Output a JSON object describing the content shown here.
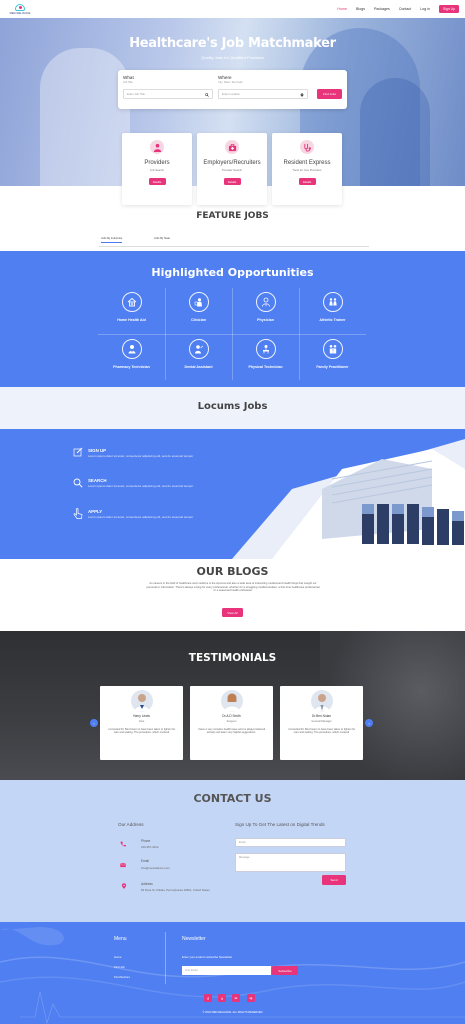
{
  "nav": {
    "logo_text": "MED-RELIANCE",
    "links": [
      "Home",
      "Blogs",
      "Packages",
      "Contact",
      "Log in"
    ],
    "signup_label": "Sign Up"
  },
  "hero": {
    "title": "Healthcare's Job Matchmaker",
    "subtitle": "Quality Jobs for Qualified Providers",
    "what_label": "What",
    "what_hint": "Job Title",
    "what_placeholder": "Enter Job Title",
    "where_label": "Where",
    "where_hint": "City, State / Zip Code",
    "where_placeholder": "Enter Location",
    "find_label": "Find Jobs"
  },
  "categories": [
    {
      "title": "Providers",
      "desc": "Job Search",
      "btn": "Details"
    },
    {
      "title": "Employers/Recruiters",
      "desc": "Provider Search",
      "btn": "Details"
    },
    {
      "title": "Resident Express",
      "desc": "Tools for new Providers",
      "btn": "Details"
    }
  ],
  "feature_jobs": {
    "title": "FEATURE JOBS",
    "tabs": [
      "Jobs By Industries",
      "Jobs By State"
    ]
  },
  "highlighted": {
    "title": "Highlighted Opportunities",
    "items": [
      {
        "label": "Home Health Aid",
        "icon": "home-health-icon"
      },
      {
        "label": "Clinician",
        "icon": "clinician-icon"
      },
      {
        "label": "Physician",
        "icon": "physician-icon"
      },
      {
        "label": "Athletic Trainer",
        "icon": "athletic-trainer-icon"
      },
      {
        "label": "Pharmacy Technician",
        "icon": "pharmacy-icon"
      },
      {
        "label": "Dental Assistant",
        "icon": "dental-icon"
      },
      {
        "label": "Physical Technician",
        "icon": "physical-technician-icon"
      },
      {
        "label": "Family Practitioner",
        "icon": "family-icon"
      }
    ]
  },
  "locums": {
    "title": "Locums Jobs",
    "steps": [
      {
        "title": "SIGN UP",
        "text": "Lorem ipsum dolor sit amet, consectetur adipiscing elit, sed do eiusmod tempor"
      },
      {
        "title": "SEARCH",
        "text": "Lorem ipsum dolor sit amet, consectetur adipiscing elit, sed do eiusmod tempor"
      },
      {
        "title": "APPLY",
        "text": "Lorem ipsum dolor sit amet, consectetur adipiscing elit, sed do eiusmod tempor"
      }
    ]
  },
  "blogs": {
    "title": "OUR BLOGS",
    "text": "As careers in the field of healthcare and medicine is the topmost and also a wide area of interesting medical and health blogs that caught our personal or information. There's always a blog for every professional, whether for a struggling medical student, a first-time healthcare professional or a seasoned health enthusiast.",
    "btn": "View All"
  },
  "testimonials": {
    "title": "TESTIMONIALS",
    "items": [
      {
        "name": "Harry Lewis",
        "role": "Care",
        "text": "I consulted Dr. Benzmann to have been taken to lighten for care and waiting. The procedure, which involved"
      },
      {
        "name": "Dr.A.D Smith",
        "role": "Surgeon",
        "text": "I have a very complex health issue and no always believed actively suit learn very helpful suggestions."
      },
      {
        "name": "Dr.Ben Nolan",
        "role": "General Manager",
        "text": "I consulted Dr. Benzmann to have been taken to lighten for care and waiting. The procedure, which involved"
      }
    ]
  },
  "contact": {
    "title": "CONTACT US",
    "address_head": "Our Address",
    "phone_label": "Phone",
    "phone_value": "310-457-3412,",
    "email_label": "Email",
    "email_value": "info@medreliance.com",
    "address_label": "Address",
    "address_value": "83 Ross St, Kittitas, Pennsylvania 19601, United States",
    "signup_head": "Sign Up To Get The Latest on Digital Trends",
    "email_placeholder": "Email",
    "message_placeholder": "Message",
    "send_label": "Send"
  },
  "footer": {
    "menu_head": "Menu",
    "menu_links": [
      "Home",
      "Find Job",
      "Find Doctors"
    ],
    "newsletter_head": "Newsletter",
    "newsletter_text": "Enter your email to subscribe Newsletter",
    "email_placeholder": "Your Email",
    "subscribe_label": "Subscribe",
    "social": [
      "f",
      "t",
      "in",
      "ig"
    ],
    "copyright": "© 2020 MED-RELIANCE. ALL RIGHTS RESERVED"
  },
  "colors": {
    "accent": "#e8347a",
    "blue": "#4f7ff1",
    "light_blue": "#c4d6f6"
  }
}
